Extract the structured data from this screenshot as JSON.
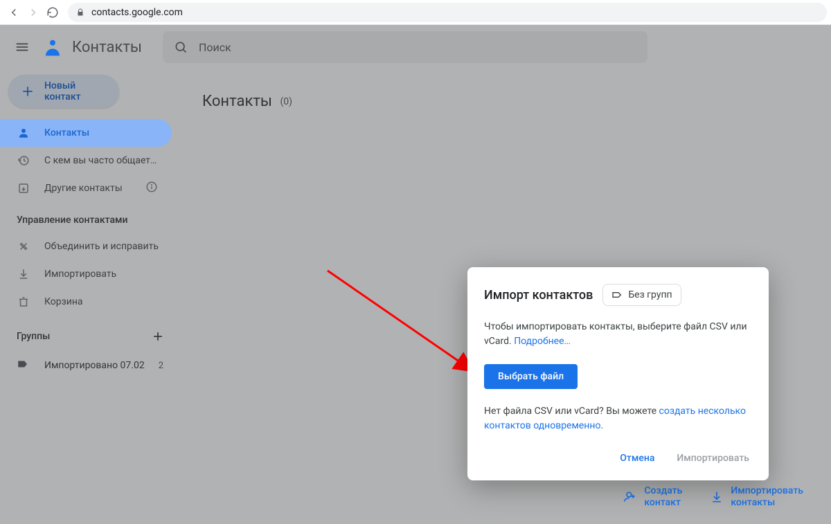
{
  "browser": {
    "url": "contacts.google.com"
  },
  "header": {
    "app_title": "Контакты",
    "search_placeholder": "Поиск"
  },
  "sidebar": {
    "new_contact": "Новый контакт",
    "items": [
      {
        "label": "Контакты"
      },
      {
        "label": "С кем вы часто общает…"
      },
      {
        "label": "Другие контакты"
      }
    ],
    "management_header": "Управление контактами",
    "management": [
      {
        "label": "Объединить и исправить"
      },
      {
        "label": "Импортировать"
      },
      {
        "label": "Корзина"
      }
    ],
    "groups_header": "Группы",
    "labels": [
      {
        "label": "Импортировано 07.02",
        "count": "2"
      }
    ]
  },
  "main": {
    "title": "Контакты",
    "count_display": "(0)"
  },
  "bottom": {
    "create": "Создать\nконтакт",
    "import": "Импортировать\nконтакты"
  },
  "dialog": {
    "title": "Импорт контактов",
    "chip": "Без групп",
    "para1a": "Чтобы импортировать контакты, выберите файл CSV или vCard. ",
    "para1_link": "Подробнее…",
    "pick_button": "Выбрать файл",
    "para2a": "Нет файла CSV или vCard? Вы можете ",
    "para2_link": "создать несколько контактов одновременно",
    "para2b": ".",
    "cancel": "Отмена",
    "import": "Импортировать"
  }
}
